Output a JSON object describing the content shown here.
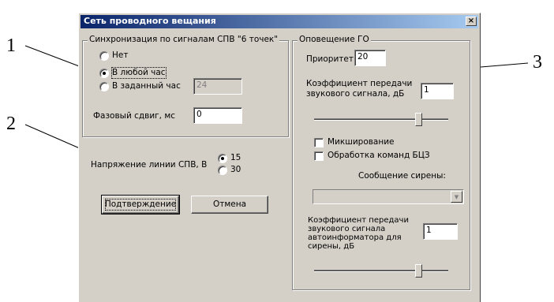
{
  "callouts": [
    "1",
    "2",
    "3"
  ],
  "window": {
    "title": "Сеть проводного вещания",
    "close_glyph": "×"
  },
  "sync": {
    "group_title": "Синхронизация по сигналам СПВ \"6 точек\"",
    "options": [
      {
        "label": "Нет",
        "checked": false
      },
      {
        "label": "В любой час",
        "checked": true
      },
      {
        "label": "В заданный час",
        "checked": false
      }
    ],
    "hour_value": "24",
    "phase_label": "Фазовый сдвиг, мс",
    "phase_value": "0"
  },
  "voltage": {
    "label": "Напряжение линии СПВ, В",
    "options": [
      {
        "label": "15",
        "checked": true
      },
      {
        "label": "30",
        "checked": false
      }
    ]
  },
  "buttons": {
    "confirm": "Подтверждение",
    "cancel": "Отмена"
  },
  "go": {
    "group_title": "Оповещение ГО",
    "priority_label": "Приоритет",
    "priority_value": "20",
    "gain_label_1": "Коэффициент передачи",
    "gain_label_2": "звукового сигнала, дБ",
    "gain_value": "1",
    "gain_slider_fraction": 0.78,
    "mixing_label": "Микширование",
    "bcz_label": "Обработка команд БЦЗ",
    "siren_label": "Сообщение сирены:",
    "siren_value": "",
    "auto_gain_lines": [
      "Коэффициент передачи",
      "звукового сигнала",
      "автоинформатора для",
      "сирены, дБ"
    ],
    "auto_gain_value": "1",
    "auto_gain_slider_fraction": 0.78
  }
}
